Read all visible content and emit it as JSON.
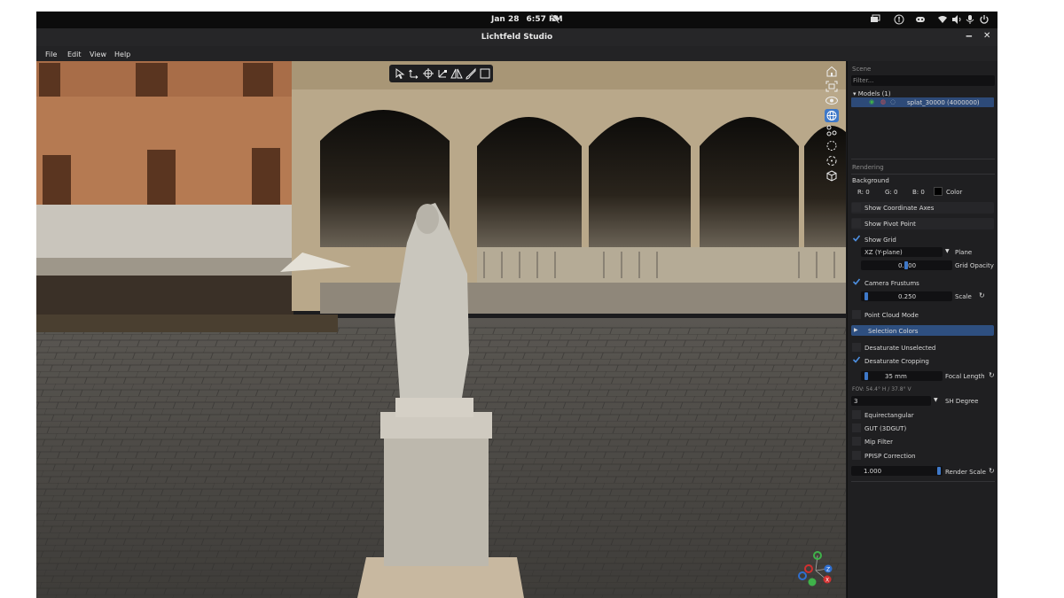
{
  "system_bar": {
    "date": "Jan 28",
    "time": "6:57 PM"
  },
  "window": {
    "title": "Lichtfeld Studio",
    "minimize": "‒",
    "close": "✕"
  },
  "menu": {
    "file": "File",
    "edit": "Edit",
    "view": "View",
    "help": "Help"
  },
  "panel": {
    "scene_header": "Scene",
    "filter_placeholder": "Filter...",
    "models_label": "Models (1)",
    "model_name": "splat_30000",
    "model_count": "(4000000)",
    "rendering_header": "Rendering",
    "background_label": "Background",
    "bg_r_label": "R:",
    "bg_r_value": "0",
    "bg_g_label": "G:",
    "bg_g_value": "0",
    "bg_b_label": "B:",
    "bg_b_value": "0",
    "color_label": "Color",
    "show_coordinate_axes": "Show Coordinate Axes",
    "show_pivot_point": "Show Pivot Point",
    "show_grid": "Show Grid",
    "plane_value": "XZ (Y-plane)",
    "plane_label": "Plane",
    "grid_opacity_value": "0.500",
    "grid_opacity_label": "Grid Opacity",
    "camera_frustums": "Camera Frustums",
    "scale_value": "0.250",
    "scale_label": "Scale",
    "point_cloud_mode": "Point Cloud Mode",
    "selection_colors": "Selection Colors",
    "desaturate_unselected": "Desaturate Unselected",
    "desaturate_cropping": "Desaturate Cropping",
    "focal_length_value": "35 mm",
    "focal_length_label": "Focal Length",
    "fov_text": "FOV: 54.4° H / 37.8° V",
    "sh_degree_value": "3",
    "sh_degree_label": "SH Degree",
    "equirectangular": "Equirectangular",
    "gut": "GUT (3DGUT)",
    "mip_filter": "Mip Filter",
    "ppisp_correction": "PPISP Correction",
    "render_scale_value": "1.000",
    "render_scale_label": "Render Scale"
  },
  "state": {
    "show_grid": true,
    "camera_frustums": true,
    "desaturate_cropping": true,
    "show_coordinate_axes": false,
    "show_pivot_point": false,
    "point_cloud_mode": false,
    "desaturate_unselected": false,
    "equirectangular": false,
    "gut": false,
    "mip_filter": false,
    "ppisp_correction": false
  },
  "gizmo": {
    "y": "Y",
    "z": "Z",
    "x": "X"
  },
  "colors": {
    "accent": "#3e78c8",
    "panel_bg": "#1f1f21",
    "selected_row": "#2d4a78"
  },
  "icons": [
    "arrow-cursor-icon",
    "translate-icon",
    "rotate-icon",
    "scale-icon",
    "mirror-icon",
    "brush-icon",
    "crop-box-icon",
    "home-icon",
    "focus-icon",
    "eye-icon",
    "globe-icon",
    "nodes-icon",
    "select-circle-icon",
    "lasso-icon",
    "cube-icon"
  ]
}
